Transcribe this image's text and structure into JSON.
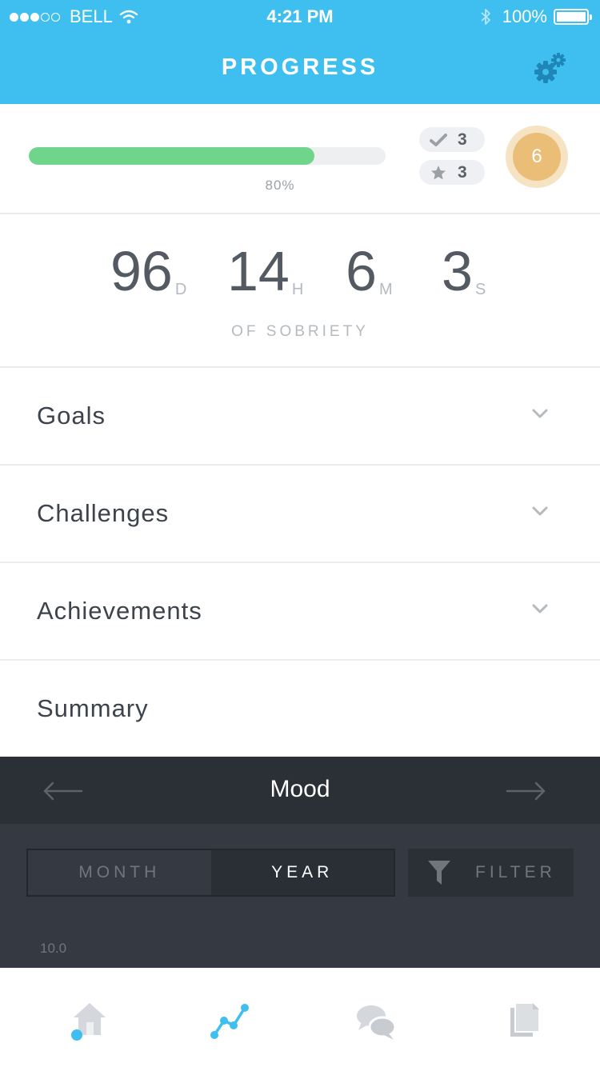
{
  "status_bar": {
    "carrier": "BELL",
    "time": "4:21 PM",
    "battery": "100%",
    "signal_strength": 3,
    "signal_max": 5
  },
  "header": {
    "title": "PROGRESS",
    "settings_icon": "gear-icon"
  },
  "progress": {
    "value": 0.8,
    "label": "80%",
    "bar_color": "#6fd58a",
    "checks_count": "3",
    "stars_count": "3",
    "level": "6"
  },
  "sobriety": {
    "days": "96",
    "days_unit": "D",
    "hours": "14",
    "hours_unit": "H",
    "minutes": "6",
    "minutes_unit": "M",
    "seconds": "3",
    "seconds_unit": "S",
    "caption": "OF SOBRIETY"
  },
  "sections": [
    {
      "label": "Goals",
      "icon": "chevron-down-icon"
    },
    {
      "label": "Challenges",
      "icon": "chevron-down-icon"
    },
    {
      "label": "Achievements",
      "icon": "chevron-down-icon"
    },
    {
      "label": "Summary"
    }
  ],
  "mood": {
    "title": "Mood",
    "prev_icon": "arrow-left-icon",
    "next_icon": "arrow-right-icon",
    "range_options": [
      "MONTH",
      "YEAR"
    ],
    "selected_range": "YEAR",
    "filter_label": "FILTER",
    "y_max_label": "10.0"
  },
  "tabs": [
    {
      "name": "home",
      "icon": "home-icon"
    },
    {
      "name": "progress",
      "icon": "chart-icon",
      "active": true
    },
    {
      "name": "chat",
      "icon": "chat-icon"
    },
    {
      "name": "documents",
      "icon": "document-icon"
    }
  ],
  "colors": {
    "accent": "#3ebfef",
    "level": "#ebbe78",
    "dark": "#2b2f36"
  }
}
